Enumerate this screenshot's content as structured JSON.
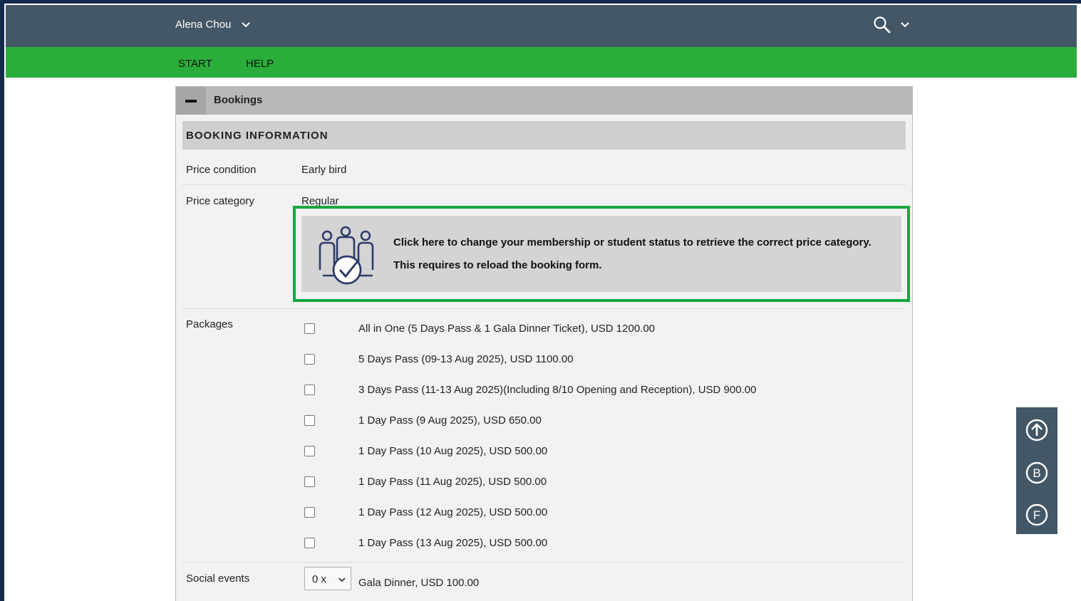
{
  "header": {
    "user_name": "Alena Chou",
    "icons": [
      "chevron-down-icon",
      "search-icon"
    ]
  },
  "nav": {
    "items": [
      {
        "label": "START"
      },
      {
        "label": "HELP"
      }
    ]
  },
  "panel": {
    "title": "Bookings",
    "section_title": "BOOKING INFORMATION",
    "price_condition": {
      "label": "Price condition",
      "value": "Early bird"
    },
    "price_category": {
      "label": "Price category",
      "value": "Regular"
    },
    "membership_notice": {
      "line1": "Click here to change your membership or student status to retrieve the correct price category.",
      "line2": "This requires to reload the booking form.",
      "icon": "group-check-icon"
    },
    "packages": {
      "label": "Packages",
      "items": [
        {
          "label": "All in One (5 Days Pass & 1 Gala Dinner Ticket), USD 1200.00",
          "checked": false
        },
        {
          "label": "5 Days Pass (09-13 Aug 2025), USD 1100.00",
          "checked": false
        },
        {
          "label": "3 Days Pass (11-13 Aug 2025)(Including 8/10 Opening and Reception), USD 900.00",
          "checked": false
        },
        {
          "label": "1 Day Pass (9 Aug 2025), USD 650.00",
          "checked": false
        },
        {
          "label": "1 Day Pass (10 Aug 2025), USD 500.00",
          "checked": false
        },
        {
          "label": "1 Day Pass (11 Aug 2025), USD 500.00",
          "checked": false
        },
        {
          "label": "1 Day Pass (12 Aug 2025), USD 500.00",
          "checked": false
        },
        {
          "label": "1 Day Pass (13 Aug 2025), USD 500.00",
          "checked": false
        }
      ]
    },
    "social_events": {
      "label": "Social events",
      "quantity": "0 x",
      "event": "Gala Dinner, USD 100.00"
    }
  },
  "side_tools": {
    "buttons": [
      {
        "icon": "arrow-up-circle-icon",
        "letter": ""
      },
      {
        "icon": "letter-b-circle-icon",
        "letter": "B"
      },
      {
        "icon": "letter-f-circle-icon",
        "letter": "F"
      }
    ]
  },
  "colors": {
    "topbar": "#435766",
    "navbar": "#2aad3b",
    "highlight_border": "#14a83c",
    "frame": "#142a4a"
  }
}
